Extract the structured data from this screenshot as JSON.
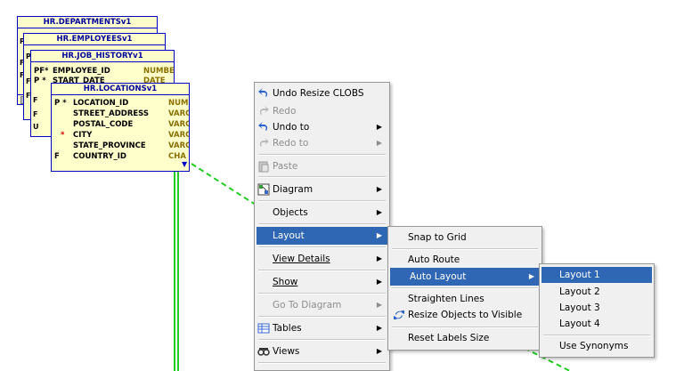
{
  "diagram": {
    "tables": [
      {
        "title": "HR.DEPARTMENTSv1",
        "side_letters": [
          "P",
          "F",
          "F"
        ]
      },
      {
        "title": "HR.EMPLOYEESv1",
        "side_letters": [
          "P",
          "F",
          "F"
        ]
      },
      {
        "title": "HR.JOB_HISTORYv1",
        "rows": [
          {
            "key": "PF*",
            "name": "EMPLOYEE_ID",
            "type": "NUMBE"
          },
          {
            "key": "P *",
            "name": "START_DATE",
            "type": "DATE"
          }
        ],
        "side_letters": [
          "F",
          "F",
          "U"
        ]
      },
      {
        "title": "HR.LOCATIONSv1",
        "rows": [
          {
            "key": "P *",
            "name": "LOCATION_ID",
            "type": "NUME"
          },
          {
            "key": "",
            "name": "STREET_ADDRESS",
            "type": "VARC"
          },
          {
            "key": "",
            "name": "POSTAL_CODE",
            "type": "VARC"
          },
          {
            "key": "*",
            "name": "CITY",
            "type": "VARC"
          },
          {
            "key": "",
            "name": "STATE_PROVINCE",
            "type": "VARC"
          },
          {
            "key": "F",
            "name": "COUNTRY_ID",
            "type": "CHA"
          }
        ]
      }
    ]
  },
  "context_menu": {
    "items": [
      {
        "label": "Undo Resize CLOBS",
        "icon": "undo-icon"
      },
      {
        "label": "Redo",
        "icon": "redo-icon"
      },
      {
        "label": "Undo to",
        "icon": "undo-icon"
      },
      {
        "label": "Redo to",
        "icon": "redo-icon"
      },
      {
        "label": "Paste",
        "icon": "paste-icon"
      },
      {
        "label": "Diagram",
        "icon": "diagram-icon"
      },
      {
        "label": "Objects"
      },
      {
        "label": "Layout"
      },
      {
        "label": "View Details"
      },
      {
        "label": "Show"
      },
      {
        "label": "Go To Diagram"
      },
      {
        "label": "Tables",
        "icon": "table-icon"
      },
      {
        "label": "Views",
        "icon": "views-icon"
      }
    ]
  },
  "layout_submenu": {
    "items": [
      {
        "label": "Snap to Grid"
      },
      {
        "label": "Auto Route"
      },
      {
        "label": "Auto Layout"
      },
      {
        "label": "Straighten Lines"
      },
      {
        "label": "Resize Objects to Visible",
        "icon": "resize-icon"
      },
      {
        "label": "Reset Labels Size"
      }
    ]
  },
  "auto_layout_submenu": {
    "items": [
      {
        "label": "Layout 1"
      },
      {
        "label": "Layout 2"
      },
      {
        "label": "Layout 3"
      },
      {
        "label": "Layout 4"
      },
      {
        "label": "Use Synonyms"
      }
    ]
  },
  "colors": {
    "table_fill": "#ffffcc",
    "table_border": "#0000c8",
    "relation_line": "#22cc22",
    "menu_selected": "#3067b5"
  }
}
